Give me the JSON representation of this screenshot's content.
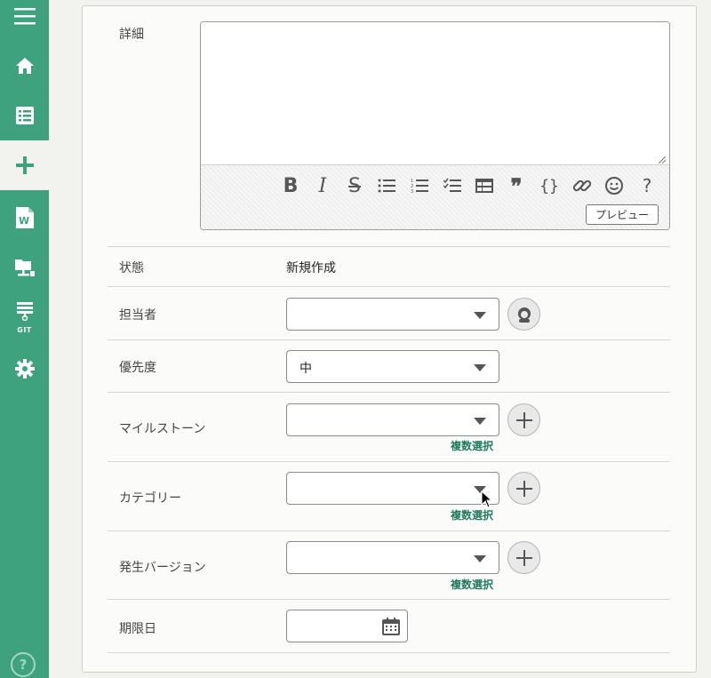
{
  "sidebar": {
    "items": [
      {
        "name": "menu",
        "icon": "hamburger-menu-icon"
      },
      {
        "name": "home",
        "icon": "home-icon"
      },
      {
        "name": "issues",
        "icon": "list-icon"
      },
      {
        "name": "add-issue",
        "icon": "plus-icon",
        "active": true
      },
      {
        "name": "wiki",
        "icon": "wiki-document-icon"
      },
      {
        "name": "files",
        "icon": "shared-files-icon"
      },
      {
        "name": "git",
        "icon": "git-icon"
      },
      {
        "name": "settings",
        "icon": "gear-icon"
      }
    ],
    "git_label": "GIT",
    "help_label": "?"
  },
  "form": {
    "detail_label": "詳細",
    "detail_value": "",
    "toolbar": {
      "icons": [
        "bold-icon",
        "italic-icon",
        "strikethrough-icon",
        "bullet-list-icon",
        "numbered-list-icon",
        "checklist-icon",
        "table-icon",
        "quote-icon",
        "code-icon",
        "link-icon",
        "emoji-icon",
        "help-icon"
      ],
      "bold": "B",
      "italic": "I",
      "strike": "S",
      "quote": "❞",
      "code": "{}",
      "help": "?",
      "preview_label": "プレビュー"
    },
    "status_label": "状態",
    "status_value": "新規作成",
    "assignee_label": "担当者",
    "assignee_value": "",
    "priority_label": "優先度",
    "priority_value": "中",
    "milestone_label": "マイルストーン",
    "milestone_value": "",
    "category_label": "カテゴリー",
    "category_value": "",
    "version_label": "発生バージョン",
    "version_value": "",
    "multi_select_label": "複数選択",
    "due_date_label": "期限日",
    "due_date_value": ""
  },
  "colors": {
    "sidebar_bg": "#3fa27f",
    "link": "#1f7a5e"
  }
}
